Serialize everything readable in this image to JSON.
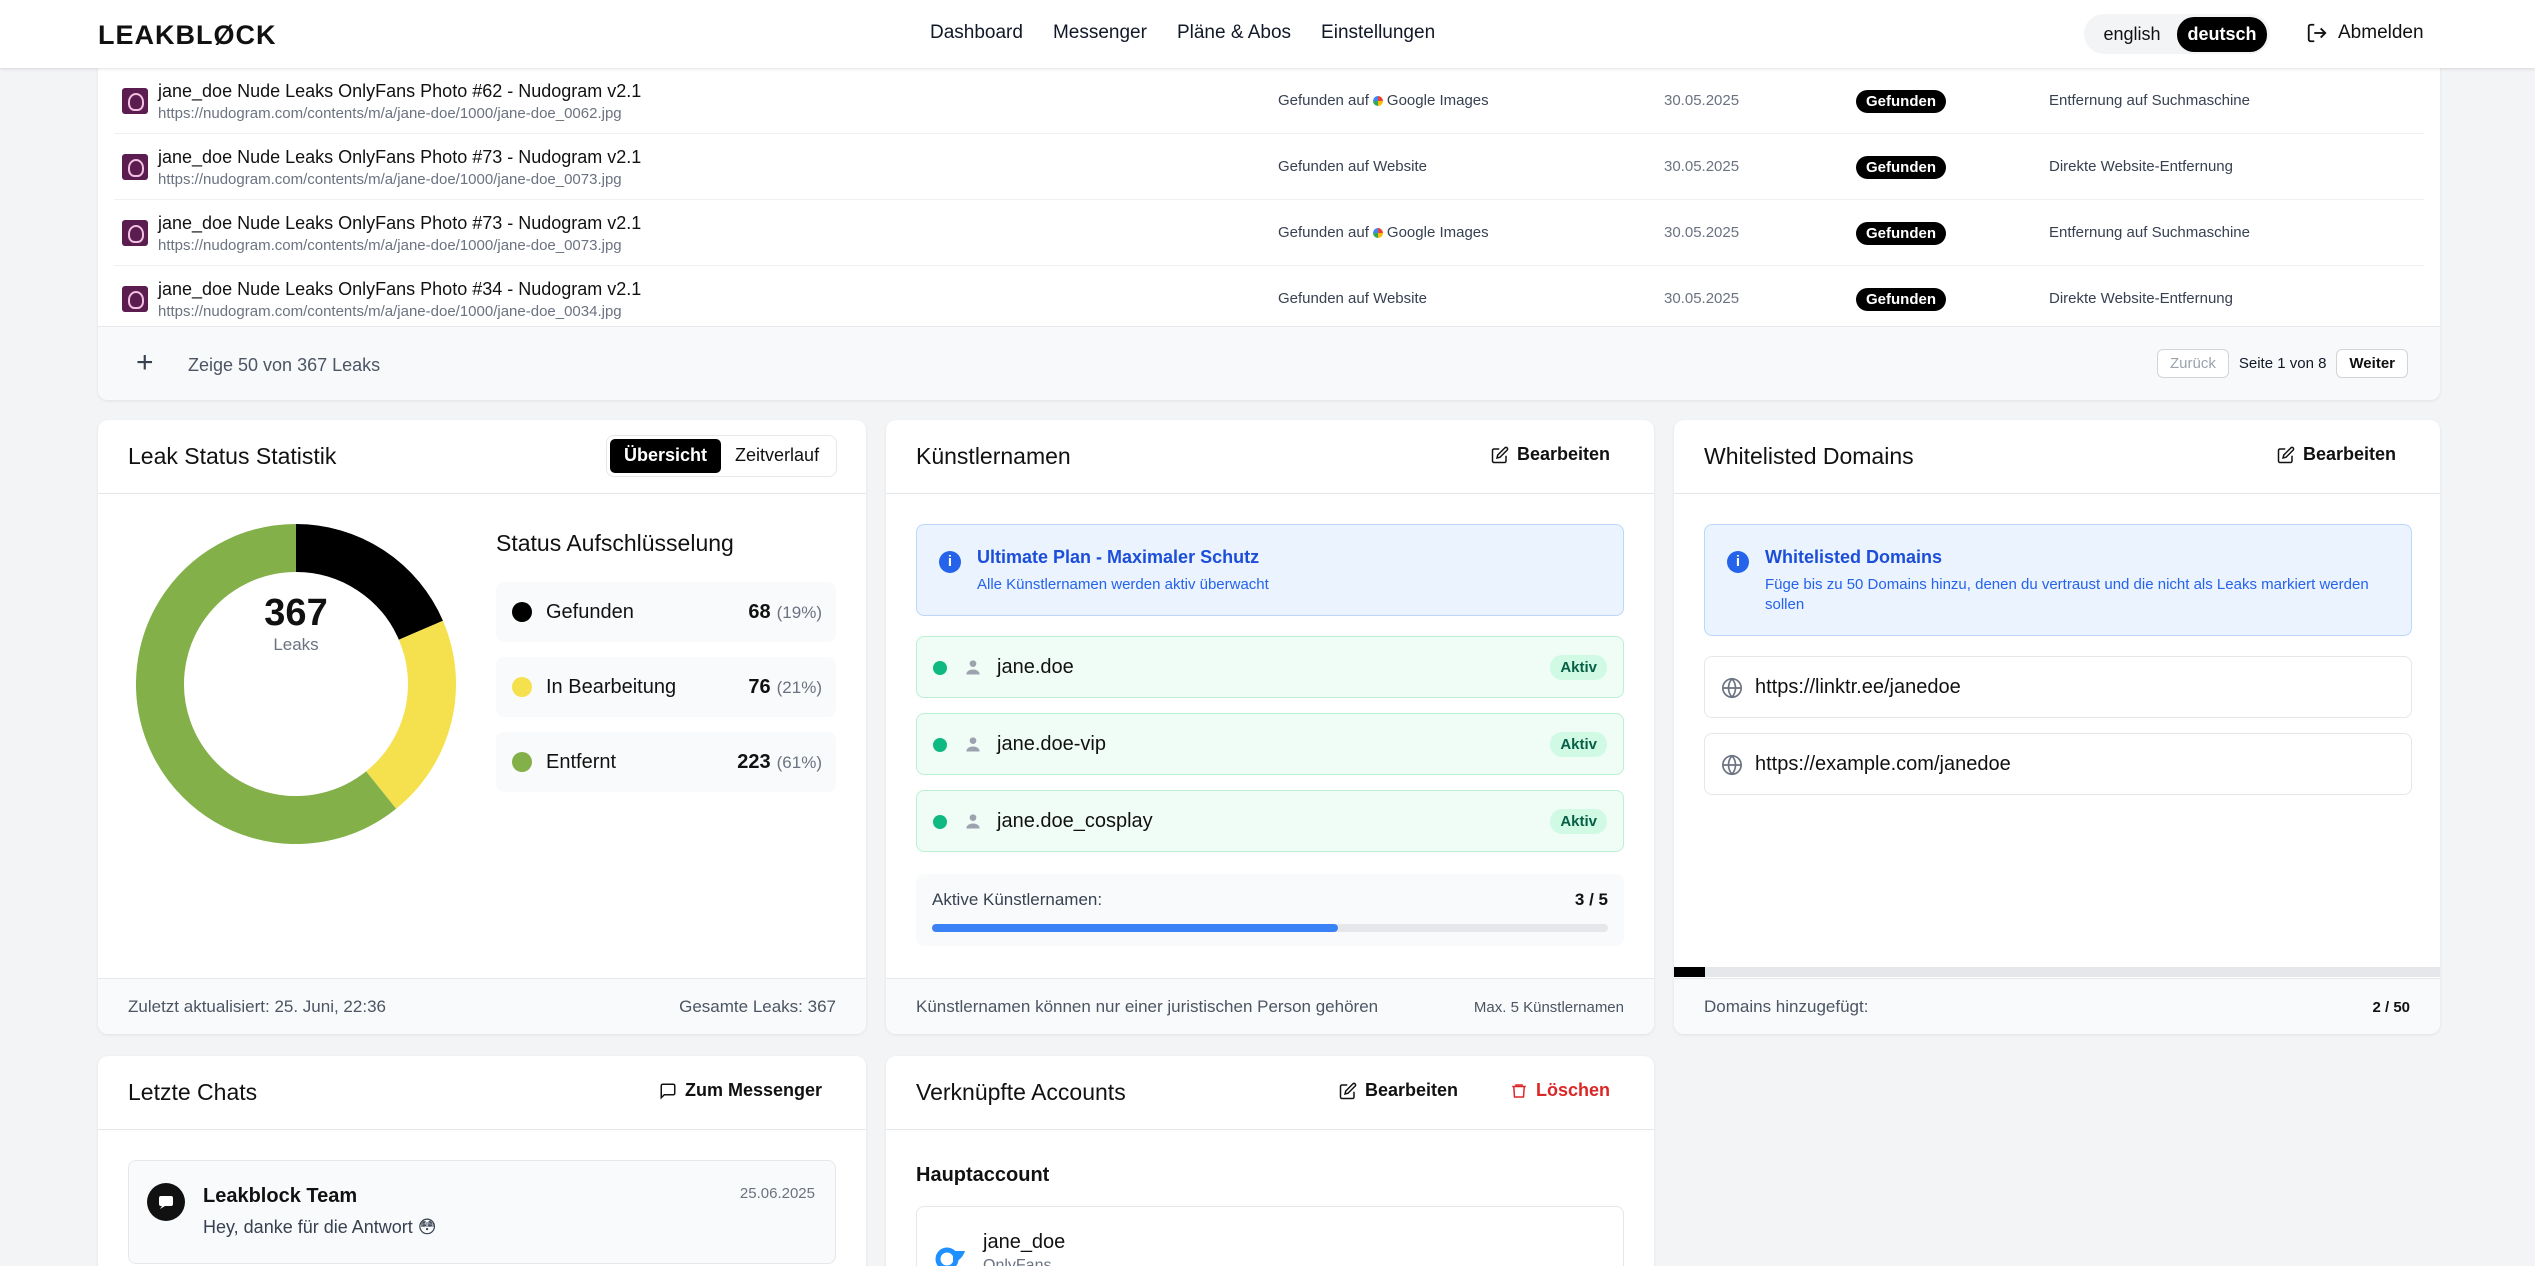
{
  "header": {
    "logo": "LEAKBLØCK",
    "nav": [
      "Dashboard",
      "Messenger",
      "Pläne & Abos",
      "Einstellungen"
    ],
    "lang": {
      "en": "english",
      "de": "deutsch"
    },
    "logout": "Abmelden"
  },
  "leaks": {
    "rows": [
      {
        "title": "jane_doe Nude Leaks OnlyFans Photo #62 - Nudogram v2.1",
        "url": "https://nudogram.com/contents/m/a/jane-doe/1000/jane-doe_0062.jpg",
        "found": "Gefunden auf",
        "source": "Google Images",
        "date": "30.05.2025",
        "status": "Gefunden",
        "action": "Entfernung auf Suchmaschine"
      },
      {
        "title": "jane_doe Nude Leaks OnlyFans Photo #73 - Nudogram v2.1",
        "url": "https://nudogram.com/contents/m/a/jane-doe/1000/jane-doe_0073.jpg",
        "found": "Gefunden auf Website",
        "source": "",
        "date": "30.05.2025",
        "status": "Gefunden",
        "action": "Direkte Website-Entfernung"
      },
      {
        "title": "jane_doe Nude Leaks OnlyFans Photo #73 - Nudogram v2.1",
        "url": "https://nudogram.com/contents/m/a/jane-doe/1000/jane-doe_0073.jpg",
        "found": "Gefunden auf",
        "source": "Google Images",
        "date": "30.05.2025",
        "status": "Gefunden",
        "action": "Entfernung auf Suchmaschine"
      },
      {
        "title": "jane_doe Nude Leaks OnlyFans Photo #34 - Nudogram v2.1",
        "url": "https://nudogram.com/contents/m/a/jane-doe/1000/jane-doe_0034.jpg",
        "found": "Gefunden auf Website",
        "source": "",
        "date": "30.05.2025",
        "status": "Gefunden",
        "action": "Direkte Website-Entfernung"
      }
    ],
    "footer": {
      "count": "Zeige 50 von 367 Leaks",
      "prev": "Zurück",
      "page": "Seite 1 von 8",
      "next": "Weiter"
    }
  },
  "stats": {
    "title": "Leak Status Statistik",
    "tabs": [
      "Übersicht",
      "Zeitverlauf"
    ],
    "total": "367",
    "total_label": "Leaks",
    "breakdown_title": "Status Aufschlüsselung",
    "foot_left": "Zuletzt aktualisiert: 25. Juni, 22:36",
    "foot_right": "Gesamte Leaks: 367",
    "colors": {
      "gefunden": "#000000",
      "bearbeitung": "#f5e04e",
      "entfernt": "#84b04a"
    }
  },
  "chart_data": {
    "type": "pie",
    "categories": [
      "Gefunden",
      "In Bearbeitung",
      "Entfernt"
    ],
    "values": [
      68,
      76,
      223
    ],
    "percent_labels": [
      "(19%)",
      "(21%)",
      "(61%)"
    ],
    "colors": [
      "#000000",
      "#f5e04e",
      "#84b04a"
    ]
  },
  "artists": {
    "title": "Künstlernamen",
    "edit": "Bearbeiten",
    "info_title": "Ultimate Plan - Maximaler Schutz",
    "info_desc": "Alle Künstlernamen werden aktiv überwacht",
    "items": [
      {
        "name": "jane.doe",
        "status": "Aktiv"
      },
      {
        "name": "jane.doe-vip",
        "status": "Aktiv"
      },
      {
        "name": "jane.doe_cosplay",
        "status": "Aktiv"
      }
    ],
    "active_label": "Aktive Künstlernamen:",
    "active_value": "3 / 5",
    "active_fraction": 0.6,
    "foot_left": "Künstlernamen können nur einer juristischen Person gehören",
    "foot_right": "Max. 5 Künstlernamen"
  },
  "domains": {
    "title": "Whitelisted Domains",
    "edit": "Bearbeiten",
    "info_title": "Whitelisted Domains",
    "info_desc": "Füge bis zu 50 Domains hinzu, denen du vertraust und die nicht als Leaks markiert werden sollen",
    "items": [
      "https://linktr.ee/janedoe",
      "https://example.com/janedoe"
    ],
    "added_label": "Domains hinzugefügt:",
    "added_value": "2 / 50",
    "added_fraction": 0.04
  },
  "chats": {
    "title": "Letzte Chats",
    "button": "Zum Messenger",
    "items": [
      {
        "name": "Leakblock Team",
        "message": "Hey, danke für die Antwort 😳",
        "date": "25.06.2025"
      }
    ]
  },
  "accounts": {
    "title": "Verknüpfte Accounts",
    "edit": "Bearbeiten",
    "delete": "Löschen",
    "main_label": "Hauptaccount",
    "main_name": "jane_doe",
    "main_sub": "OnlyFans"
  }
}
